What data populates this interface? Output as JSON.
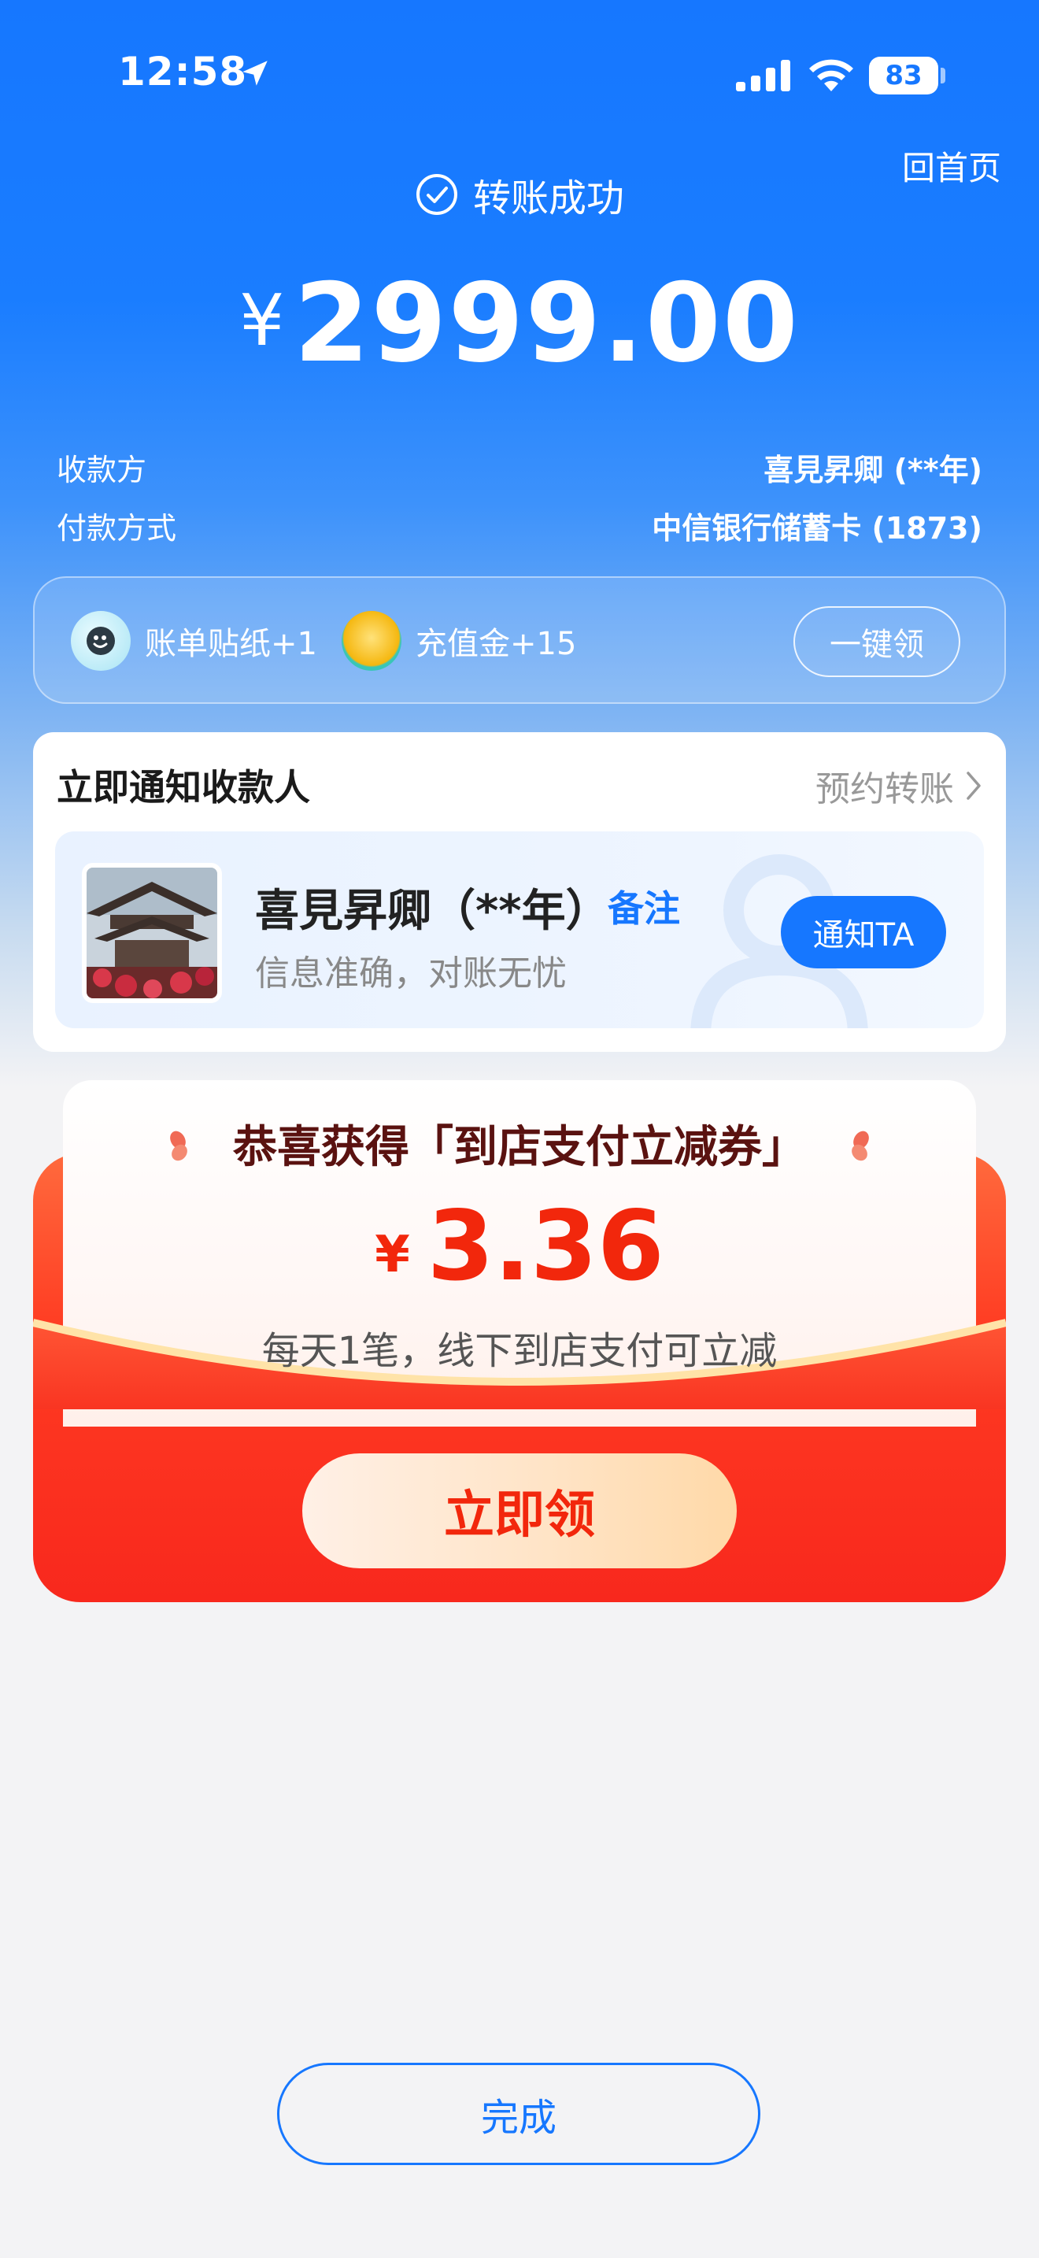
{
  "status_bar": {
    "time": "12:58",
    "battery": "83"
  },
  "header": {
    "home_link": "回首页",
    "status_text": "转账成功"
  },
  "amount": {
    "currency": "¥",
    "value": "2999.00"
  },
  "details": [
    {
      "label": "收款方",
      "value": "喜見昇卿 (**年)"
    },
    {
      "label": "付款方式",
      "value": "中信银行储蓄卡 (1873)"
    }
  ],
  "rewards": {
    "items": [
      {
        "label": "账单贴纸+1",
        "icon": "sticker-icon"
      },
      {
        "label": "充值金+15",
        "icon": "coin-icon"
      }
    ],
    "claim_all_label": "一键领"
  },
  "notify": {
    "title": "立即通知收款人",
    "schedule_label": "预约转账",
    "payee_name": "喜見昇卿（**年）",
    "remark_label": "备注",
    "payee_subtitle": "信息准确，对账无忧",
    "notify_button": "通知TA"
  },
  "coupon": {
    "title": "恭喜获得「到店支付立减券」",
    "currency": "¥",
    "amount": "3.36",
    "description": "每天1笔，线下到店支付可立减",
    "claim_label": "立即领"
  },
  "footer": {
    "done_label": "完成"
  },
  "colors": {
    "primary_blue": "#1677ff",
    "coupon_red": "#f2270c"
  }
}
